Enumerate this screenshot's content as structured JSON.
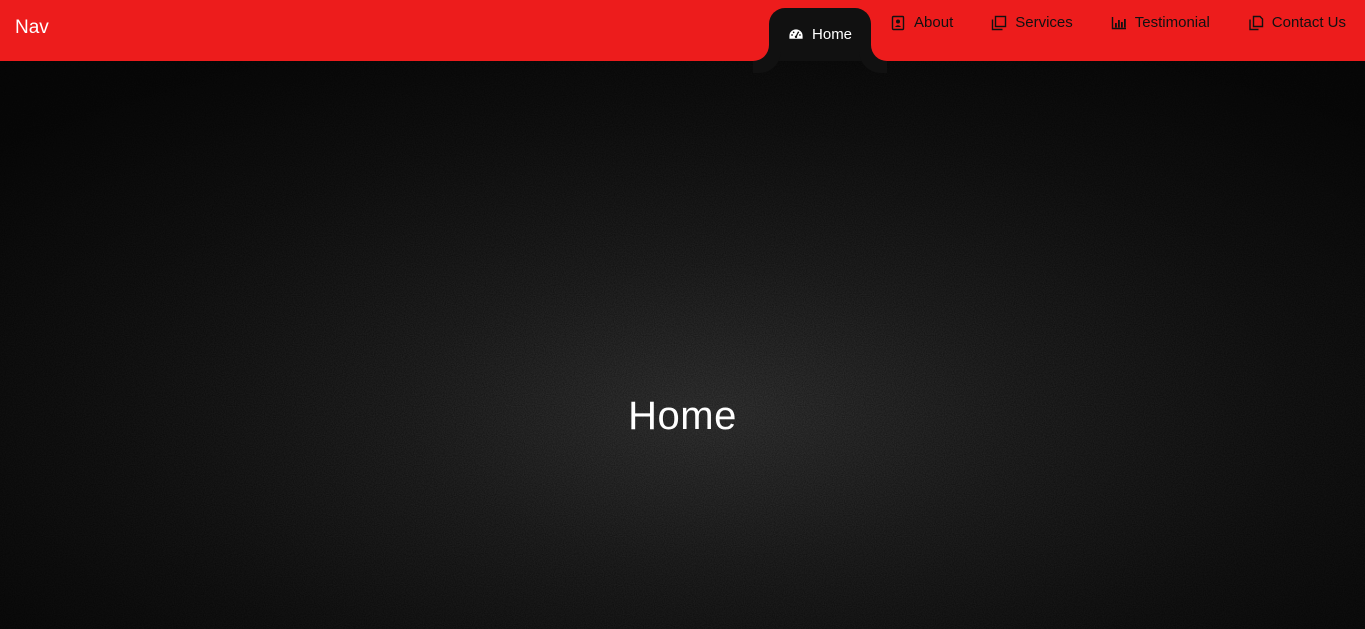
{
  "navbar": {
    "brand": "Nav",
    "background_color": "#ed1c1c",
    "active_color": "#111111",
    "items": [
      {
        "label": "Home",
        "icon": "dashboard-icon",
        "active": true
      },
      {
        "label": "About",
        "icon": "contact-card-icon",
        "active": false
      },
      {
        "label": "Services",
        "icon": "clone-icon",
        "active": false
      },
      {
        "label": "Testimonial",
        "icon": "bar-chart-icon",
        "active": false
      },
      {
        "label": "Contact Us",
        "icon": "copy-document-icon",
        "active": false
      }
    ]
  },
  "hero": {
    "title": "Home",
    "background_color": "#0a0a0a"
  }
}
